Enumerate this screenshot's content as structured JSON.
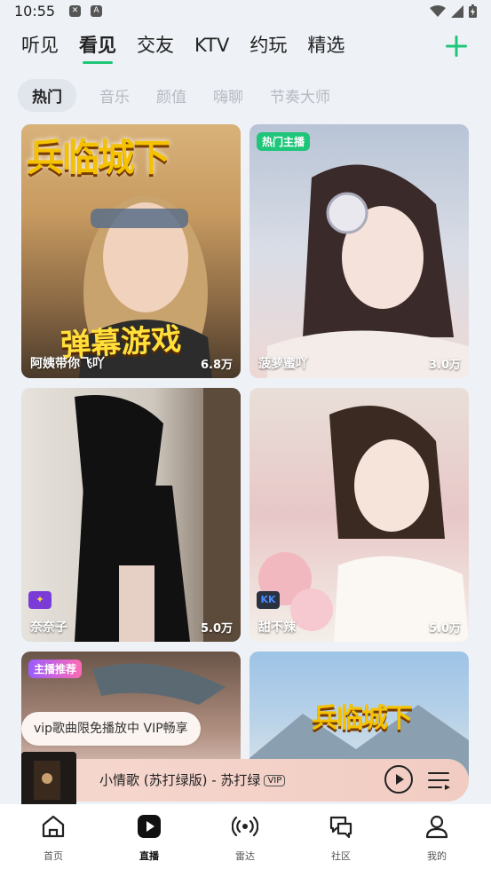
{
  "status_bar": {
    "time": "10:55"
  },
  "top_tabs": [
    {
      "label": "听见"
    },
    {
      "label": "看见"
    },
    {
      "label": "交友"
    },
    {
      "label": "KTV"
    },
    {
      "label": "约玩"
    },
    {
      "label": "精选"
    }
  ],
  "sub_tabs": [
    {
      "label": "热门"
    },
    {
      "label": "音乐"
    },
    {
      "label": "颜值"
    },
    {
      "label": "嗨聊"
    },
    {
      "label": "节奏大师"
    }
  ],
  "cards": [
    {
      "name": "阿姨带你飞吖",
      "views": "6.8万",
      "overlay_title": "兵临城下",
      "overlay_sub": "弹幕游戏"
    },
    {
      "name": "菠萝蜜吖",
      "views": "3.0万",
      "tag": "热门主播"
    },
    {
      "name": "奈奈子",
      "views": "5.0万"
    },
    {
      "name": "甜不辣",
      "views": "5.0万",
      "badge": "KK"
    },
    {
      "tag": "主播推荐"
    },
    {
      "overlay_title": "兵临城下"
    }
  ],
  "promo": {
    "text": "vip歌曲限免播放中 VIP畅享"
  },
  "player": {
    "song": "小情歌 (苏打绿版) - 苏打绿",
    "vip": "VIP"
  },
  "bottom_nav": [
    {
      "label": "首页",
      "icon": "home-icon"
    },
    {
      "label": "直播",
      "icon": "live-icon"
    },
    {
      "label": "雷达",
      "icon": "radar-icon"
    },
    {
      "label": "社区",
      "icon": "community-icon"
    },
    {
      "label": "我的",
      "icon": "profile-icon"
    }
  ],
  "colors": {
    "accent": "#1fc679",
    "background": "#eef1f6"
  }
}
